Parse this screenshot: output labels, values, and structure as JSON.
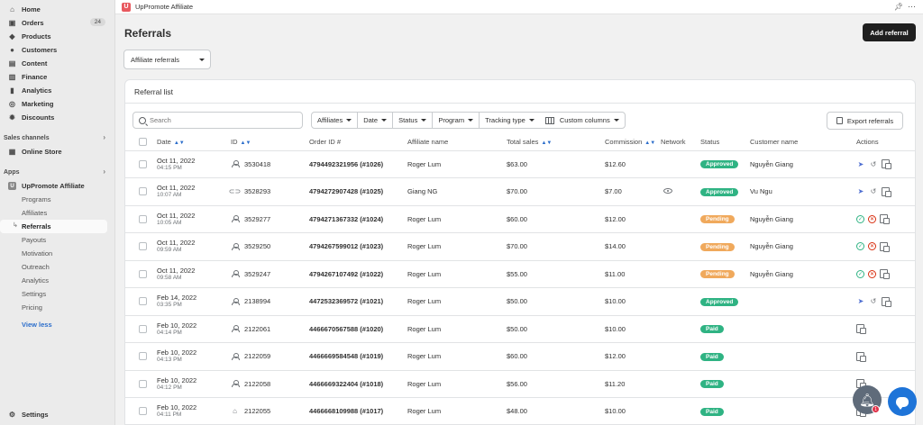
{
  "sidebar": {
    "main_items": [
      {
        "label": "Home",
        "icon": "home-icon",
        "glyph": "⌂"
      },
      {
        "label": "Orders",
        "icon": "orders-icon",
        "glyph": "▣",
        "badge": "24"
      },
      {
        "label": "Products",
        "icon": "tag-icon",
        "glyph": "◆"
      },
      {
        "label": "Customers",
        "icon": "person-icon",
        "glyph": "●"
      },
      {
        "label": "Content",
        "icon": "content-icon",
        "glyph": "▤"
      },
      {
        "label": "Finance",
        "icon": "bank-icon",
        "glyph": "▥"
      },
      {
        "label": "Analytics",
        "icon": "analytics-icon",
        "glyph": "▮"
      },
      {
        "label": "Marketing",
        "icon": "marketing-icon",
        "glyph": "◎"
      },
      {
        "label": "Discounts",
        "icon": "discount-icon",
        "glyph": "✹"
      }
    ],
    "sales_channels_label": "Sales channels",
    "online_store_label": "Online Store",
    "apps_label": "Apps",
    "app_name": "UpPromote Affiliate",
    "app_subitems": [
      "Programs",
      "Affiliates",
      "Referrals",
      "Payouts",
      "Motivation",
      "Outreach",
      "Analytics",
      "Settings",
      "Pricing"
    ],
    "view_less": "View less",
    "settings_label": "Settings"
  },
  "topbar": {
    "app_title": "UpPromote Affiliate"
  },
  "page": {
    "title": "Referrals",
    "add_button": "Add referral",
    "select_value": "Affiliate referrals"
  },
  "card": {
    "title": "Referral list",
    "search_placeholder": "Search",
    "filters": [
      "Affiliates",
      "Date",
      "Status",
      "Program",
      "Tracking type"
    ],
    "custom_columns": "Custom columns",
    "export": "Export referrals"
  },
  "table": {
    "headers": {
      "date": "Date",
      "id": "ID",
      "order_id": "Order ID #",
      "affiliate": "Affiliate name",
      "total_sales": "Total sales",
      "commission": "Commission",
      "network": "Network",
      "status": "Status",
      "customer": "Customer name",
      "actions": "Actions"
    },
    "rows": [
      {
        "date": "Oct 11, 2022",
        "time": "04:15 PM",
        "id": "3530418",
        "id_icon": "user",
        "order": "4794492321956 (#1026)",
        "affiliate": "Roger Lum",
        "sales": "$63.00",
        "commission": "$12.60",
        "network": "",
        "status": "Approved",
        "status_kind": "approved",
        "customer": "Nguyễn Giang",
        "actions": "approved"
      },
      {
        "date": "Oct 11, 2022",
        "time": "10:07 AM",
        "id": "3528293",
        "id_icon": "link",
        "order": "4794272907428 (#1025)",
        "affiliate": "Giang NG",
        "sales": "$70.00",
        "commission": "$7.00",
        "network": "eye",
        "status": "Approved",
        "status_kind": "approved",
        "customer": "Vu Ngu",
        "actions": "approved"
      },
      {
        "date": "Oct 11, 2022",
        "time": "10:05 AM",
        "id": "3529277",
        "id_icon": "user",
        "order": "4794271367332 (#1024)",
        "affiliate": "Roger Lum",
        "sales": "$60.00",
        "commission": "$12.00",
        "network": "",
        "status": "Pending",
        "status_kind": "pending",
        "customer": "Nguyễn Giang",
        "actions": "pending"
      },
      {
        "date": "Oct 11, 2022",
        "time": "09:59 AM",
        "id": "3529250",
        "id_icon": "user",
        "order": "4794267599012 (#1023)",
        "affiliate": "Roger Lum",
        "sales": "$70.00",
        "commission": "$14.00",
        "network": "",
        "status": "Pending",
        "status_kind": "pending",
        "customer": "Nguyễn Giang",
        "actions": "pending"
      },
      {
        "date": "Oct 11, 2022",
        "time": "09:58 AM",
        "id": "3529247",
        "id_icon": "user",
        "order": "4794267107492 (#1022)",
        "affiliate": "Roger Lum",
        "sales": "$55.00",
        "commission": "$11.00",
        "network": "",
        "status": "Pending",
        "status_kind": "pending",
        "customer": "Nguyễn Giang",
        "actions": "pending"
      },
      {
        "date": "Feb 14, 2022",
        "time": "03:35 PM",
        "id": "2138994",
        "id_icon": "user",
        "order": "4472532369572 (#1021)",
        "affiliate": "Roger Lum",
        "sales": "$50.00",
        "commission": "$10.00",
        "network": "",
        "status": "Approved",
        "status_kind": "approved",
        "customer": "",
        "actions": "approved"
      },
      {
        "date": "Feb 10, 2022",
        "time": "04:14 PM",
        "id": "2122061",
        "id_icon": "user",
        "order": "4466670567588 (#1020)",
        "affiliate": "Roger Lum",
        "sales": "$50.00",
        "commission": "$10.00",
        "network": "",
        "status": "Paid",
        "status_kind": "paid",
        "customer": "",
        "actions": "paid"
      },
      {
        "date": "Feb 10, 2022",
        "time": "04:13 PM",
        "id": "2122059",
        "id_icon": "user",
        "order": "4466669584548 (#1019)",
        "affiliate": "Roger Lum",
        "sales": "$60.00",
        "commission": "$12.00",
        "network": "",
        "status": "Paid",
        "status_kind": "paid",
        "customer": "",
        "actions": "paid"
      },
      {
        "date": "Feb 10, 2022",
        "time": "04:12 PM",
        "id": "2122058",
        "id_icon": "user",
        "order": "4466669322404 (#1018)",
        "affiliate": "Roger Lum",
        "sales": "$56.00",
        "commission": "$11.20",
        "network": "",
        "status": "Paid",
        "status_kind": "paid",
        "customer": "",
        "actions": "paid"
      },
      {
        "date": "Feb 10, 2022",
        "time": "04:11 PM",
        "id": "2122055",
        "id_icon": "tag",
        "order": "4466668109988 (#1017)",
        "affiliate": "Roger Lum",
        "sales": "$48.00",
        "commission": "$10.00",
        "network": "",
        "status": "Paid",
        "status_kind": "paid",
        "customer": "",
        "actions": "paid"
      }
    ]
  },
  "colors": {
    "approved": "#2fb383",
    "pending": "#f0a95c",
    "paid": "#2fb383",
    "accent": "#2c6ecb"
  },
  "notification_count": "1"
}
